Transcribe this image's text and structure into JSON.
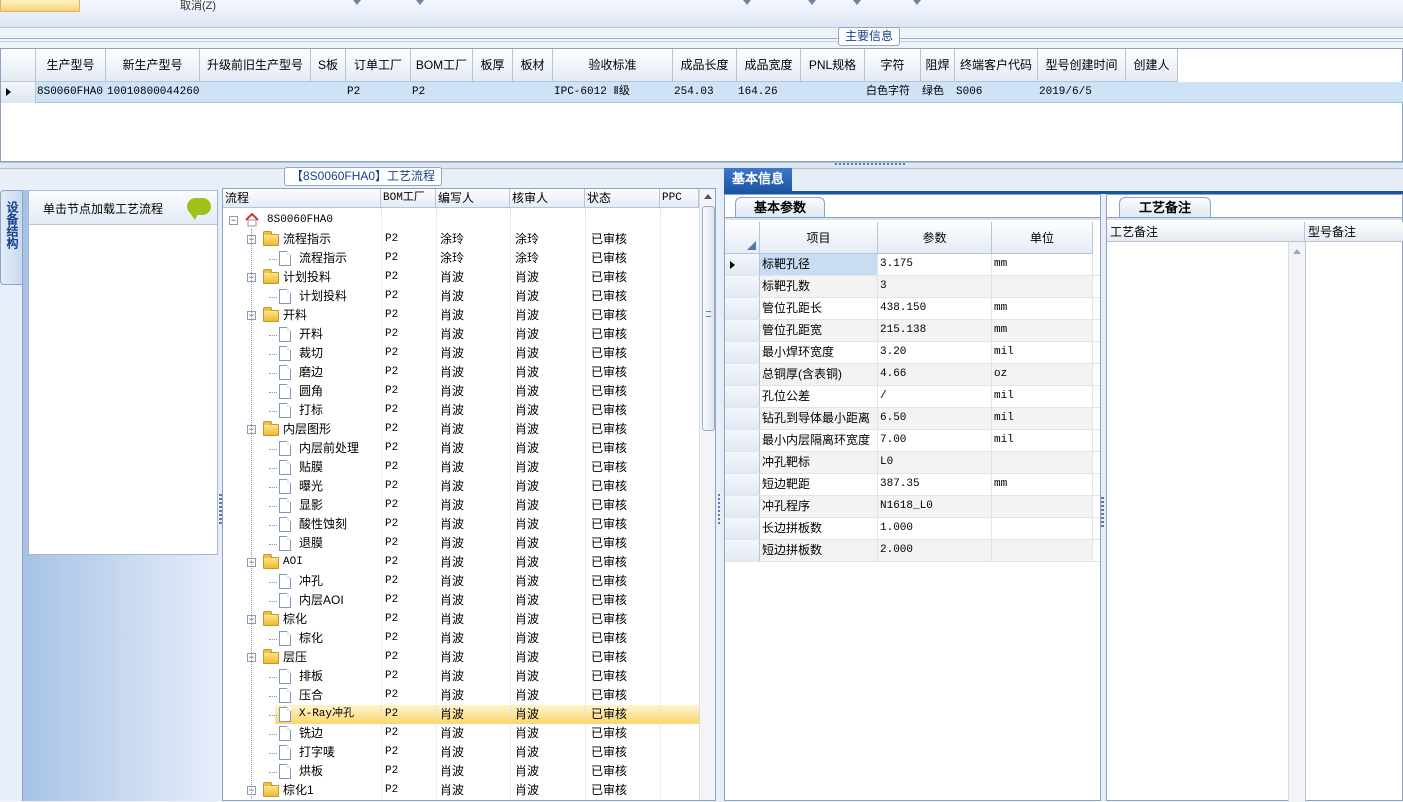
{
  "toolbar": {
    "cancel_label": "取消(Z)"
  },
  "main_info": {
    "title": "主要信息",
    "columns": [
      "生产型号",
      "新生产型号",
      "升级前旧生产型号",
      "S板",
      "订单工厂",
      "BOM工厂",
      "板厚",
      "板材",
      "验收标准",
      "成品长度",
      "成品宽度",
      "PNL规格",
      "字符",
      "阻焊",
      "终端客户代码",
      "型号创建时间",
      "创建人"
    ],
    "row": [
      "8S0060FHA0",
      "10010800044260",
      "",
      "",
      "P2",
      "P2",
      "",
      "",
      "IPC-6012 Ⅱ级",
      "254.03",
      "164.26",
      "",
      "白色字符",
      "绿色",
      "S006",
      "2019/6/5",
      ""
    ]
  },
  "left_tab": {
    "vertical_label": "设备结构",
    "load_hint": "单击节点加载工艺流程"
  },
  "process": {
    "title": "【8S0060FHA0】工艺流程",
    "columns": [
      "流程",
      "BOM工厂",
      "编写人",
      "核审人",
      "状态",
      "PPC"
    ],
    "rows": [
      {
        "level": 0,
        "type": "root",
        "name": "8S0060FHA0",
        "bom": "",
        "writer": "",
        "reviewer": "",
        "status": ""
      },
      {
        "level": 1,
        "type": "folder",
        "name": "流程指示",
        "bom": "P2",
        "writer": "涂玲",
        "reviewer": "涂玲",
        "status": "已审核"
      },
      {
        "level": 2,
        "type": "doc",
        "name": "流程指示",
        "bom": "P2",
        "writer": "涂玲",
        "reviewer": "涂玲",
        "status": "已审核"
      },
      {
        "level": 1,
        "type": "folder",
        "name": "计划投料",
        "bom": "P2",
        "writer": "肖波",
        "reviewer": "肖波",
        "status": "已审核"
      },
      {
        "level": 2,
        "type": "doc",
        "name": "计划投料",
        "bom": "P2",
        "writer": "肖波",
        "reviewer": "肖波",
        "status": "已审核"
      },
      {
        "level": 1,
        "type": "folder",
        "name": "开料",
        "bom": "P2",
        "writer": "肖波",
        "reviewer": "肖波",
        "status": "已审核"
      },
      {
        "level": 2,
        "type": "doc",
        "name": "开料",
        "bom": "P2",
        "writer": "肖波",
        "reviewer": "肖波",
        "status": "已审核"
      },
      {
        "level": 2,
        "type": "doc",
        "name": "裁切",
        "bom": "P2",
        "writer": "肖波",
        "reviewer": "肖波",
        "status": "已审核"
      },
      {
        "level": 2,
        "type": "doc",
        "name": "磨边",
        "bom": "P2",
        "writer": "肖波",
        "reviewer": "肖波",
        "status": "已审核"
      },
      {
        "level": 2,
        "type": "doc",
        "name": "圆角",
        "bom": "P2",
        "writer": "肖波",
        "reviewer": "肖波",
        "status": "已审核"
      },
      {
        "level": 2,
        "type": "doc",
        "name": "打标",
        "bom": "P2",
        "writer": "肖波",
        "reviewer": "肖波",
        "status": "已审核"
      },
      {
        "level": 1,
        "type": "folder",
        "name": "内层图形",
        "bom": "P2",
        "writer": "肖波",
        "reviewer": "肖波",
        "status": "已审核"
      },
      {
        "level": 2,
        "type": "doc",
        "name": "内层前处理",
        "bom": "P2",
        "writer": "肖波",
        "reviewer": "肖波",
        "status": "已审核"
      },
      {
        "level": 2,
        "type": "doc",
        "name": "贴膜",
        "bom": "P2",
        "writer": "肖波",
        "reviewer": "肖波",
        "status": "已审核"
      },
      {
        "level": 2,
        "type": "doc",
        "name": "曝光",
        "bom": "P2",
        "writer": "肖波",
        "reviewer": "肖波",
        "status": "已审核"
      },
      {
        "level": 2,
        "type": "doc",
        "name": "显影",
        "bom": "P2",
        "writer": "肖波",
        "reviewer": "肖波",
        "status": "已审核"
      },
      {
        "level": 2,
        "type": "doc",
        "name": "酸性蚀刻",
        "bom": "P2",
        "writer": "肖波",
        "reviewer": "肖波",
        "status": "已审核"
      },
      {
        "level": 2,
        "type": "doc",
        "name": "退膜",
        "bom": "P2",
        "writer": "肖波",
        "reviewer": "肖波",
        "status": "已审核"
      },
      {
        "level": 1,
        "type": "folder",
        "name": "AOI",
        "bom": "P2",
        "writer": "肖波",
        "reviewer": "肖波",
        "status": "已审核"
      },
      {
        "level": 2,
        "type": "doc",
        "name": "冲孔",
        "bom": "P2",
        "writer": "肖波",
        "reviewer": "肖波",
        "status": "已审核"
      },
      {
        "level": 2,
        "type": "doc",
        "name": "内层AOI",
        "bom": "P2",
        "writer": "肖波",
        "reviewer": "肖波",
        "status": "已审核"
      },
      {
        "level": 1,
        "type": "folder",
        "name": "棕化",
        "bom": "P2",
        "writer": "肖波",
        "reviewer": "肖波",
        "status": "已审核"
      },
      {
        "level": 2,
        "type": "doc",
        "name": "棕化",
        "bom": "P2",
        "writer": "肖波",
        "reviewer": "肖波",
        "status": "已审核"
      },
      {
        "level": 1,
        "type": "folder",
        "name": "层压",
        "bom": "P2",
        "writer": "肖波",
        "reviewer": "肖波",
        "status": "已审核"
      },
      {
        "level": 2,
        "type": "doc",
        "name": "排板",
        "bom": "P2",
        "writer": "肖波",
        "reviewer": "肖波",
        "status": "已审核"
      },
      {
        "level": 2,
        "type": "doc",
        "name": "压合",
        "bom": "P2",
        "writer": "肖波",
        "reviewer": "肖波",
        "status": "已审核"
      },
      {
        "level": 2,
        "type": "doc",
        "name": "X-Ray冲孔",
        "bom": "P2",
        "writer": "肖波",
        "reviewer": "肖波",
        "status": "已审核",
        "selected": true
      },
      {
        "level": 2,
        "type": "doc",
        "name": "铣边",
        "bom": "P2",
        "writer": "肖波",
        "reviewer": "肖波",
        "status": "已审核"
      },
      {
        "level": 2,
        "type": "doc",
        "name": "打字唛",
        "bom": "P2",
        "writer": "肖波",
        "reviewer": "肖波",
        "status": "已审核"
      },
      {
        "level": 2,
        "type": "doc",
        "name": "烘板",
        "bom": "P2",
        "writer": "肖波",
        "reviewer": "肖波",
        "status": "已审核"
      },
      {
        "level": 1,
        "type": "folder",
        "name": "棕化1",
        "bom": "P2",
        "writer": "肖波",
        "reviewer": "肖波",
        "status": "已审核"
      }
    ]
  },
  "basic_info": {
    "tab": "基本信息",
    "sub_tab": "基本参数",
    "columns": [
      "项目",
      "参数",
      "单位"
    ],
    "rows": [
      [
        "标靶孔径",
        "3.175",
        "mm"
      ],
      [
        "标靶孔数",
        "3",
        ""
      ],
      [
        "管位孔距长",
        "438.150",
        "mm"
      ],
      [
        "管位孔距宽",
        "215.138",
        "mm"
      ],
      [
        "最小焊环宽度",
        "3.20",
        "mil"
      ],
      [
        "总铜厚(含表铜)",
        "4.66",
        "oz"
      ],
      [
        "孔位公差",
        "/",
        "mil"
      ],
      [
        "钻孔到导体最小距离",
        "6.50",
        "mil"
      ],
      [
        "最小内层隔离环宽度",
        "7.00",
        "mil"
      ],
      [
        "冲孔靶标",
        "L0",
        ""
      ],
      [
        "短边靶距",
        "387.35",
        "mm"
      ],
      [
        "冲孔程序",
        "N1618_L0",
        ""
      ],
      [
        "长边拼板数",
        "1.000",
        ""
      ],
      [
        "短边拼板数",
        "2.000",
        ""
      ]
    ]
  },
  "notes": {
    "tab": "工艺备注",
    "col1": "工艺备注",
    "col2": "型号备注"
  },
  "colors": {
    "accent": "#1c55a4",
    "selection": "#fbd56a",
    "row_highlight": "#cfe3f8"
  }
}
